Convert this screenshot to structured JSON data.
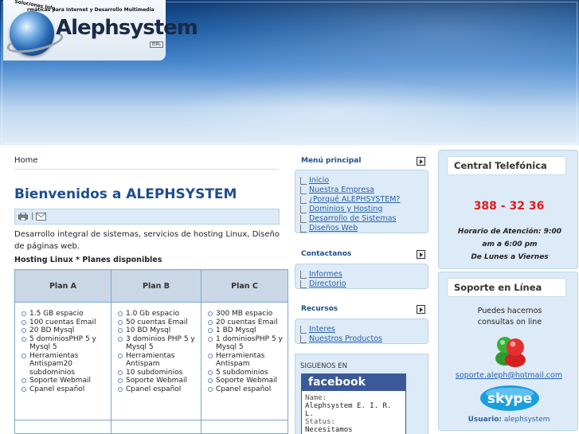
{
  "header": {
    "logo_tagline_top": "Soluciones Info",
    "logo_tagline": "rmáticas para Internet y Desarrollo Multimedia",
    "logo_name": "Alephsystem",
    "logo_suffix": "EIRL"
  },
  "main": {
    "breadcrumb": "Home",
    "title": "Bienvenidos a ALEPHSYSTEM",
    "tool_separator": "|",
    "intro": "Desarrollo integral de sistemas, servicios de hosting Linux, Diseño de páginas web.",
    "hosting_title": "Hosting Linux * Planes disponibles",
    "plans": [
      {
        "name": "Plan A",
        "features": [
          "1.5 GB espacio",
          "100 cuentas Email",
          "20 BD Mysql",
          "5 dominiosPHP 5 y Mysql 5",
          "Herramientas Antispam20 subdominios",
          "Soporte Webmail",
          "Cpanel español"
        ]
      },
      {
        "name": "Plan B",
        "features": [
          "1.0 Gb espacio",
          "50 cuentas Email",
          "10 BD Mysql",
          "3 dominios PHP 5 y Mysql 5",
          "Herramientas Antispam",
          "10 subdominios",
          "Soporte Webmail",
          "Cpanel español"
        ]
      },
      {
        "name": "Plan C",
        "features": [
          "300 MB espacio",
          "20 cuentas Email",
          "1 BD Mysql",
          "1 dominiosPHP 5 y Mysql 5",
          "Herramientas Antispam",
          "5 subdominios",
          "Soporte Webmail",
          "Cpanel español"
        ]
      }
    ]
  },
  "menu": {
    "principal": {
      "title": "Menú principal",
      "items": [
        "Inicio",
        "Nuestra Empresa",
        "¿Porqué ALEPHSYSTEM?",
        "Dominios y Hosting",
        "Desarrollo de Sistemas",
        "Diseños Web"
      ]
    },
    "contactanos": {
      "title": "Contactanos",
      "items": [
        "Informes",
        "Directorio"
      ]
    },
    "recursos": {
      "title": "Recursos",
      "items": [
        "Interes",
        "Nuestros Productos"
      ]
    },
    "siguenos": {
      "title": "SIGUENOS EN",
      "brand": "facebook",
      "name_label": "Name:",
      "name_value": "Alephsystem E. I. R. L.",
      "status_label": "Status:",
      "status_value": "Necesitamos"
    }
  },
  "right": {
    "central": {
      "title": "Central Telefónica",
      "phone": "388 - 32 36",
      "hours_line1": "Horario de Atención: 9:00",
      "hours_line2": "am a 6:00 pm",
      "hours_line3": "De Lunes a Viernes"
    },
    "soporte": {
      "title": "Soporte en Línea",
      "text_line1": "Puedes hacernos",
      "text_line2": "consultas on line",
      "email": "soporte.aleph@hotmail.com",
      "skype_label": "Usuario:",
      "skype_user": "alephsystem"
    }
  },
  "colors": {
    "title_blue": "#1f4e8c",
    "link_blue": "#2b5fa8",
    "phone_red": "#e01b1b",
    "panel_bg": "#dcebf7"
  }
}
